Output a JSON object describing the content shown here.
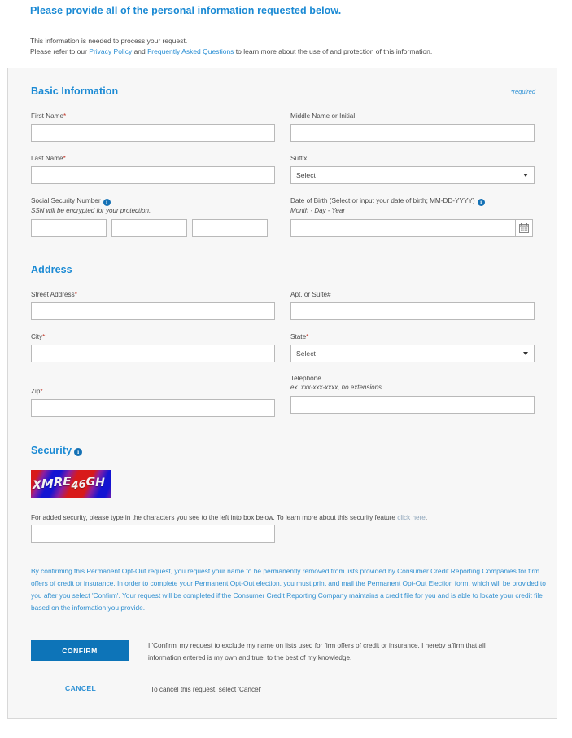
{
  "intro": {
    "title": "Please provide all of the personal information requested below.",
    "line1": "This information is needed to process your request.",
    "line2_prefix": "Please refer to our ",
    "privacy_link": "Privacy Policy",
    "line2_mid": " and ",
    "faq_link": "Frequently Asked Questions",
    "line2_suffix": " to learn more about the use of and protection of this information."
  },
  "basic_information": {
    "heading": "Basic Information",
    "required_note": "*required",
    "first_name": {
      "label": "First Name",
      "required_mark": "*",
      "value": ""
    },
    "middle_name": {
      "label": "Middle Name or Initial",
      "value": ""
    },
    "last_name": {
      "label": "Last Name",
      "required_mark": "*",
      "value": ""
    },
    "suffix": {
      "label": "Suffix",
      "selected": "Select"
    },
    "ssn": {
      "label": "Social Security Number",
      "info_icon": "info-icon",
      "note": "SSN will be encrypted for your protection.",
      "part1": "",
      "part2": "",
      "part3": ""
    },
    "dob": {
      "label": "Date of Birth (Select or input your date of birth; MM-DD-YYYY)",
      "info_icon": "info-icon",
      "format_hint": "Month - Day - Year",
      "value": "",
      "calendar_icon": "calendar-icon"
    }
  },
  "address": {
    "heading": "Address",
    "street": {
      "label": "Street Address",
      "required_mark": "*",
      "value": ""
    },
    "apt": {
      "label": "Apt. or Suite#",
      "value": ""
    },
    "city": {
      "label": "City",
      "required_mark": "*",
      "value": ""
    },
    "state": {
      "label": "State",
      "required_mark": "*",
      "selected": "Select"
    },
    "zip": {
      "label": "Zip",
      "required_mark": "*",
      "value": ""
    },
    "telephone": {
      "label": "Telephone",
      "hint": "ex. xxx-xxx-xxxx, no extensions",
      "value": ""
    }
  },
  "security": {
    "heading": "Security",
    "info_icon": "info-icon",
    "captcha_text": "XMRE46GH",
    "captcha_chars": [
      "X",
      "M",
      "R",
      "E",
      "4",
      "6",
      "G",
      "H"
    ],
    "help_prefix": "For added security, please type in the characters you see to the left into box below. To learn more about this security feature ",
    "help_link": "click here",
    "help_suffix": ".",
    "answer_value": ""
  },
  "legal_text": "By confirming this Permanent Opt-Out request, you request your name to be permanently removed from lists provided by Consumer Credit Reporting Companies for firm offers of credit or insurance. In order to complete your Permanent Opt-Out election, you must print and mail the Permanent Opt-Out Election form, which will be provided to you after you select 'Confirm'. Your request will be completed if the Consumer Credit Reporting Company maintains a credit file for you and is able to locate your credit file based on the information you provide.",
  "actions": {
    "confirm_label": "CONFIRM",
    "confirm_description": "I 'Confirm' my request to exclude my name on lists used for firm offers of credit or insurance. I hereby affirm that all information entered is my own and true, to the best of my knowledge.",
    "cancel_label": "CANCEL",
    "cancel_description": "To cancel this request, select 'Cancel'"
  },
  "colors": {
    "accent_blue": "#1b8ad4",
    "link_blue": "#2a8fd4",
    "button_blue": "#0d74b8",
    "panel_bg": "#f7f7f7",
    "required_red": "#c0392b"
  }
}
